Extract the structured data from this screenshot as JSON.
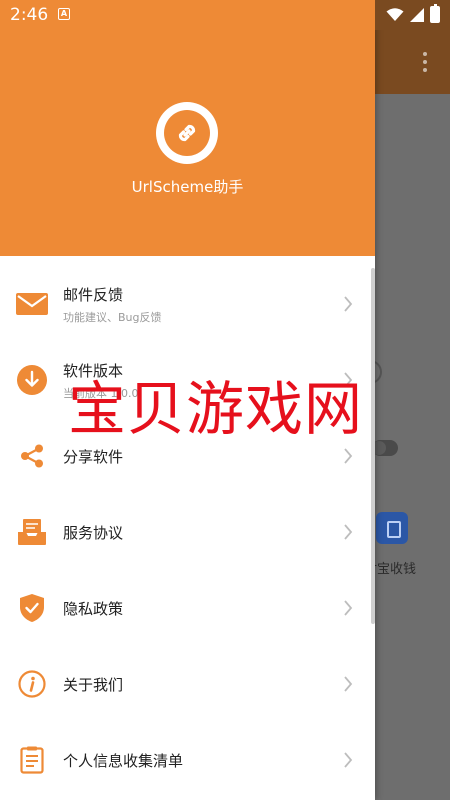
{
  "status_bar": {
    "time": "2:46",
    "notification_letter": "A"
  },
  "background_app": {
    "label": "付宝收钱"
  },
  "drawer": {
    "app_name": "UrlScheme助手",
    "items": [
      {
        "title": "邮件反馈",
        "subtitle": "功能建议、Bug反馈",
        "icon": "mail-icon"
      },
      {
        "title": "软件版本",
        "subtitle": "当前版本 1.0.0",
        "icon": "download-icon"
      },
      {
        "title": "分享软件",
        "subtitle": "",
        "icon": "share-icon"
      },
      {
        "title": "服务协议",
        "subtitle": "",
        "icon": "inbox-icon"
      },
      {
        "title": "隐私政策",
        "subtitle": "",
        "icon": "shield-check-icon"
      },
      {
        "title": "关于我们",
        "subtitle": "",
        "icon": "info-icon"
      },
      {
        "title": "个人信息收集清单",
        "subtitle": "",
        "icon": "clipboard-icon"
      }
    ]
  },
  "watermark": {
    "text": "宝贝游戏网"
  },
  "colors": {
    "accent": "#ee8a36",
    "watermark": "#e6101c",
    "title_text": "#222222",
    "subtitle_text": "#9a9a9a"
  }
}
